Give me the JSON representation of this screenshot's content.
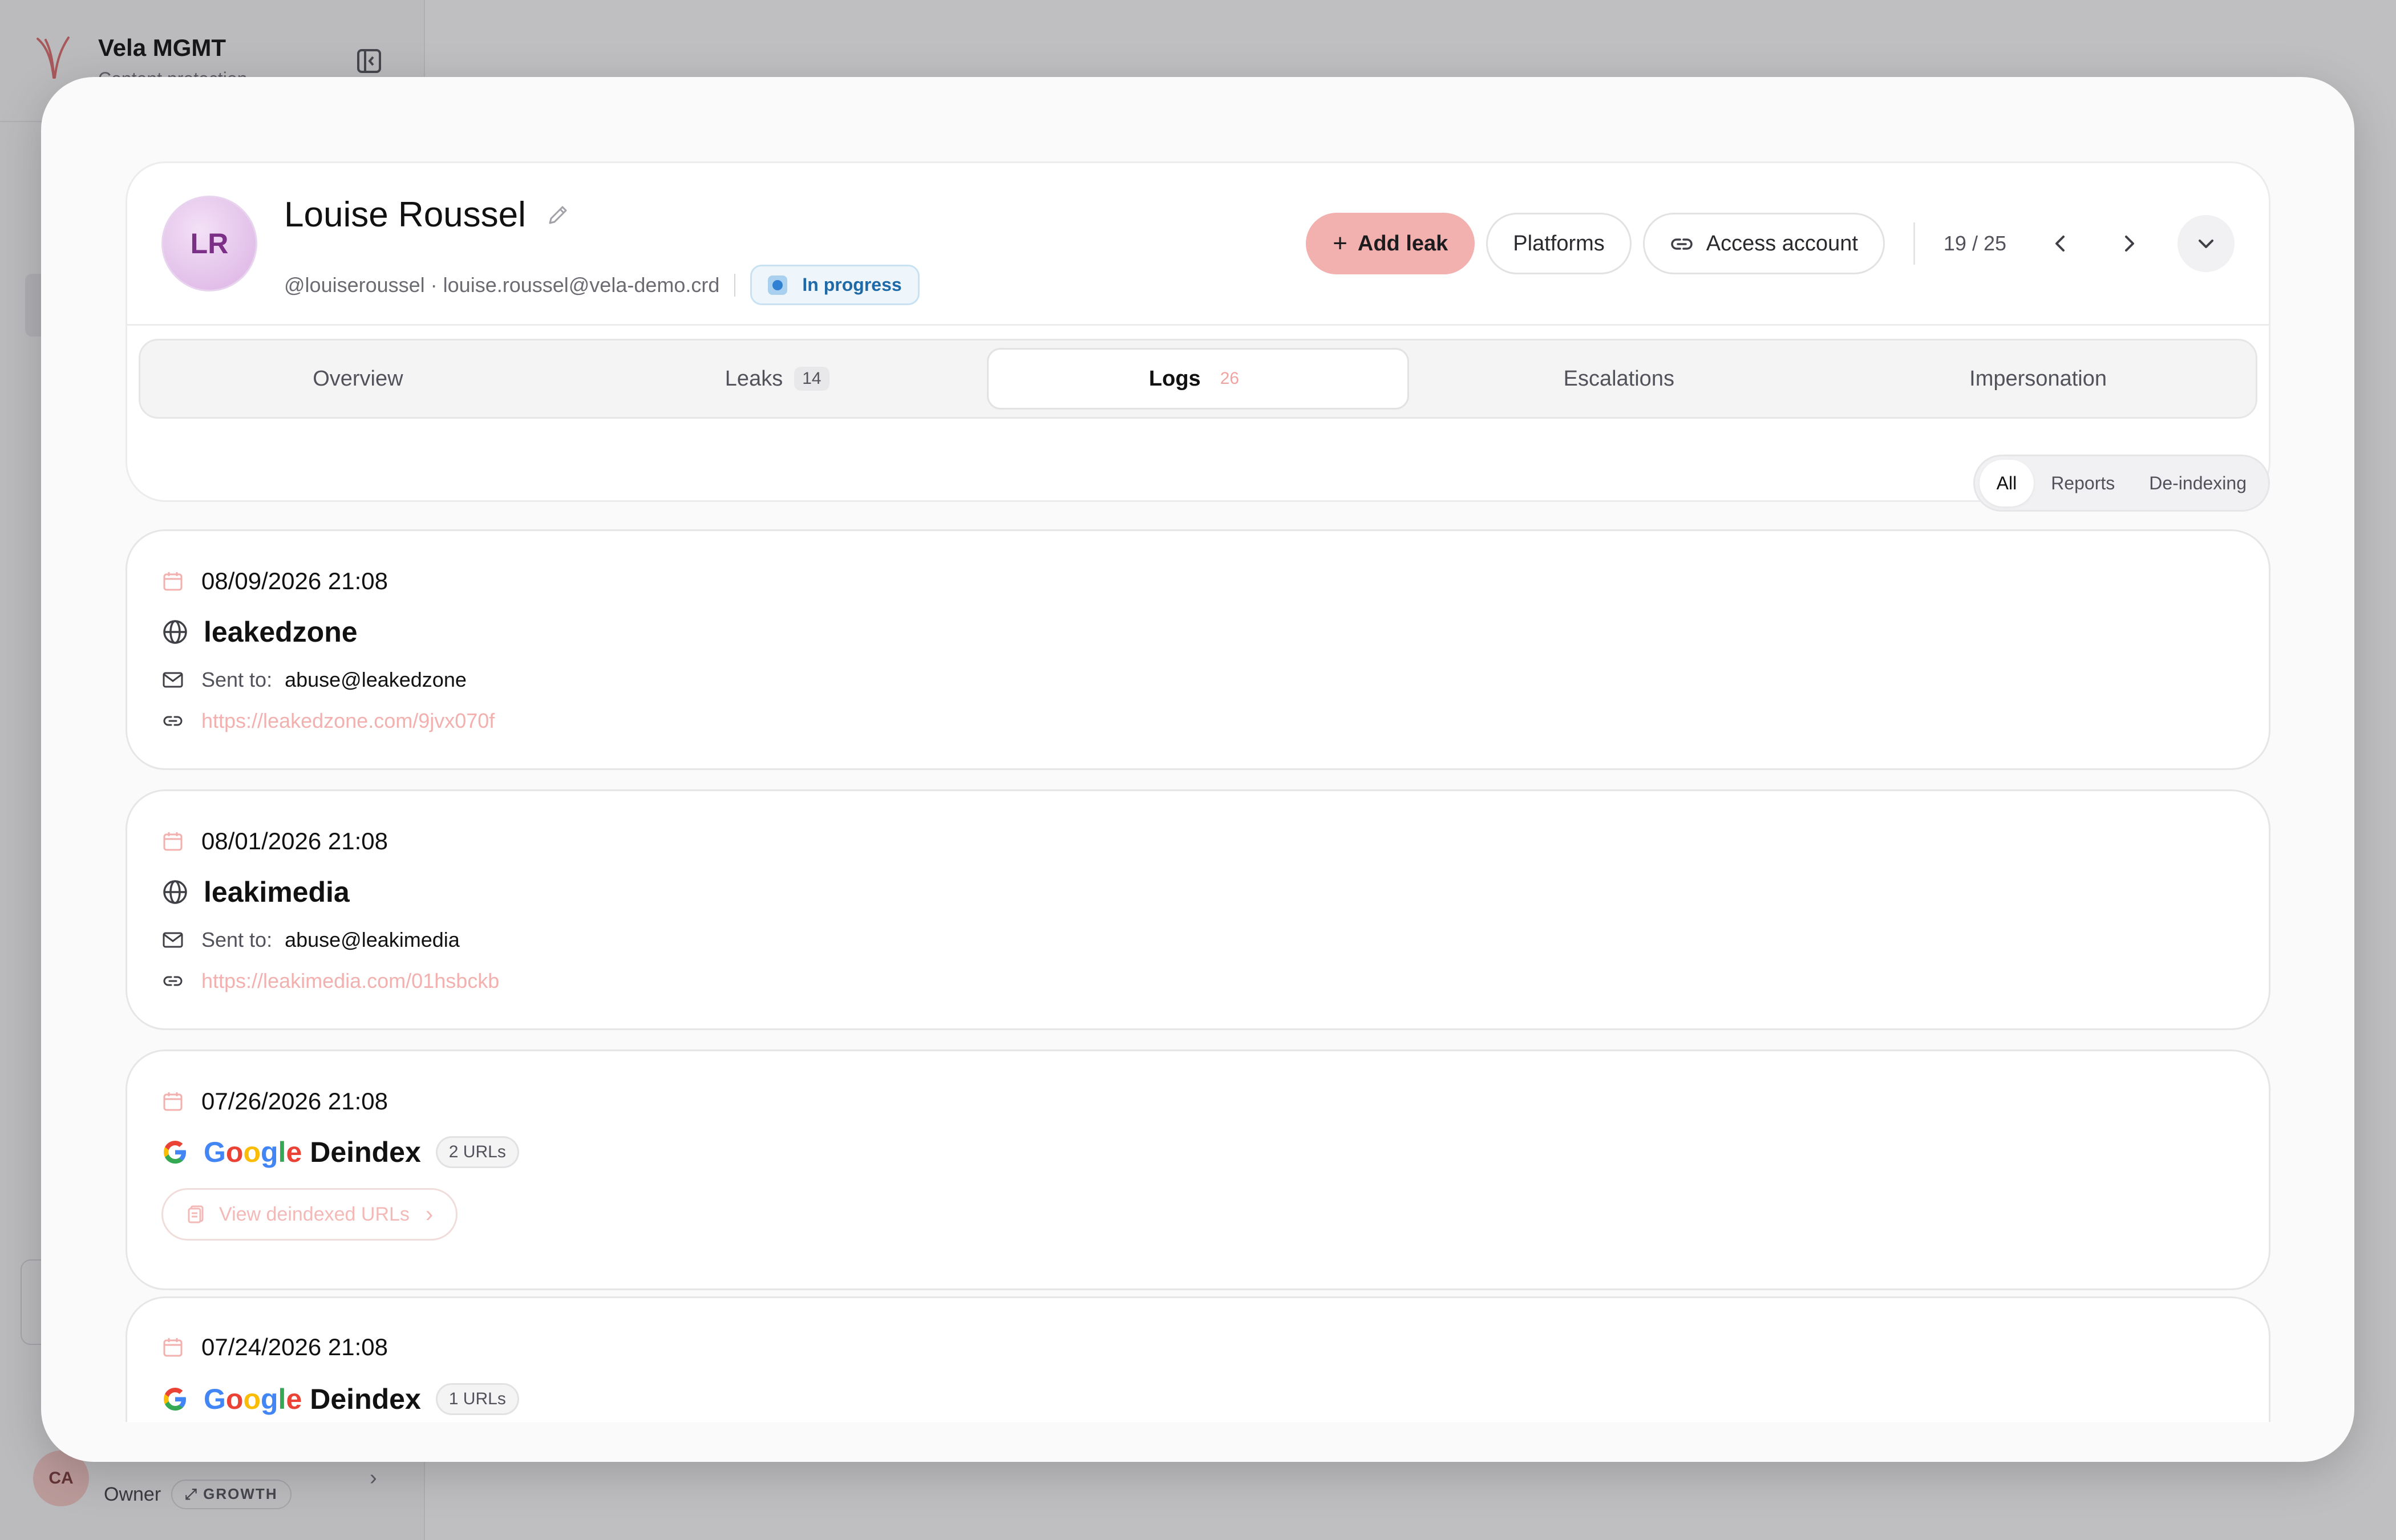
{
  "app": {
    "brand_name": "Vela MGMT",
    "brand_sub": "Content protection",
    "user_initials": "CA",
    "user_role": "Owner",
    "user_plan": "GROWTH"
  },
  "profile": {
    "initials": "LR",
    "name": "Louise Roussel",
    "handle_email": "@louiseroussel · louise.roussel@vela-demo.crd",
    "status": "In progress"
  },
  "actions": {
    "add_leak": "Add leak",
    "platforms": "Platforms",
    "access_account": "Access account",
    "pager": "19 / 25"
  },
  "tabs": [
    {
      "label": "Overview",
      "count": ""
    },
    {
      "label": "Leaks",
      "count": "14"
    },
    {
      "label": "Logs",
      "count": "26"
    },
    {
      "label": "Escalations",
      "count": ""
    },
    {
      "label": "Impersonation",
      "count": ""
    }
  ],
  "filter": {
    "options": [
      "All",
      "Reports",
      "De-indexing"
    ],
    "selected": "All"
  },
  "logs": [
    {
      "date": "08/09/2026 21:08",
      "platform": "leakedzone",
      "sent_label": "Sent to:",
      "sent_to": "abuse@leakedzone",
      "url": "https://leakedzone.com/9jvx070f"
    },
    {
      "date": "08/01/2026 21:08",
      "platform": "leakimedia",
      "sent_label": "Sent to:",
      "sent_to": "abuse@leakimedia",
      "url": "https://leakimedia.com/01hsbckb"
    },
    {
      "date": "07/26/2026 21:08",
      "google": "Google",
      "title": "Deindex",
      "url_count": "2 URLs",
      "view_label": "View deindexed URLs"
    },
    {
      "date": "07/24/2026 21:08",
      "google": "Google",
      "title": "Deindex",
      "url_count": "1 URLs"
    }
  ],
  "colors": {
    "accent": "#f2b0ae",
    "status_blue": "#1e6aa8",
    "avatar_purple": "#7b2f87"
  },
  "icons": {
    "calendar": "calendar-icon",
    "globe": "globe-icon",
    "mail": "mail-icon",
    "link": "link-icon",
    "google": "google-g-icon"
  }
}
